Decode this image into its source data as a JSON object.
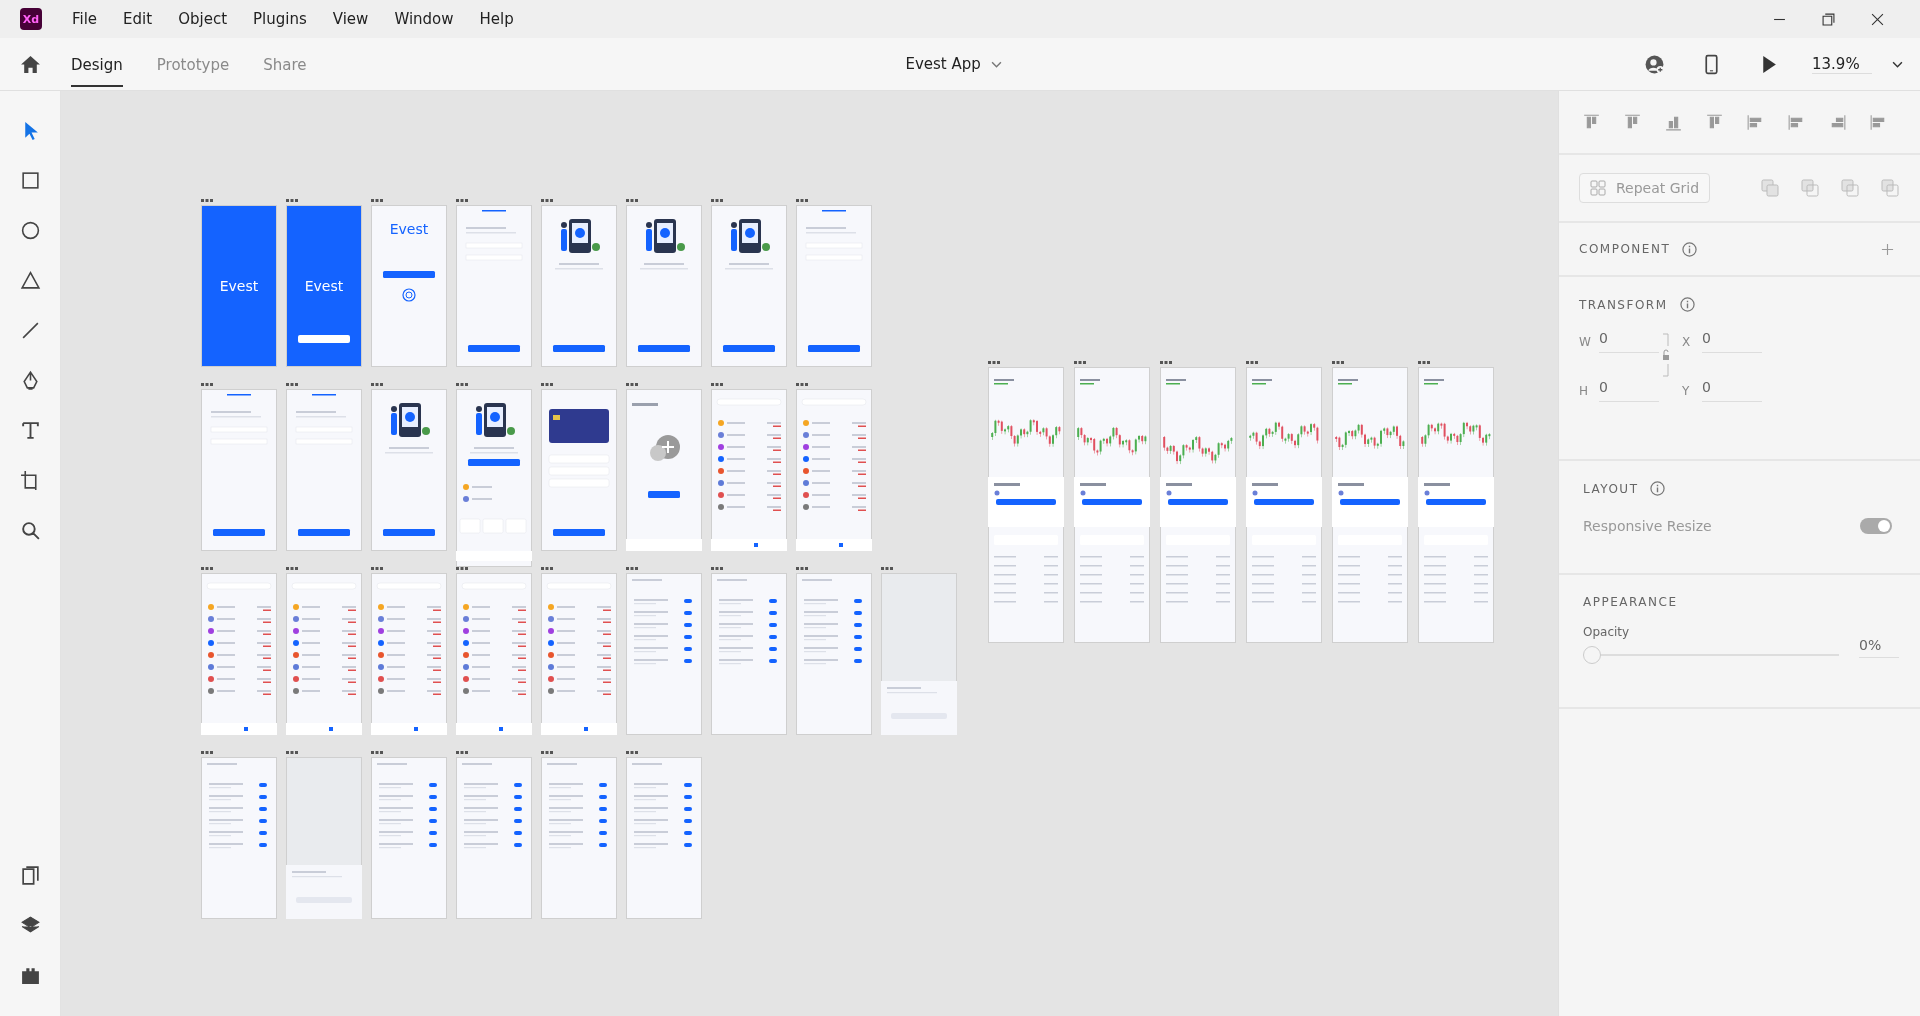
{
  "app": {
    "logo": "Xd"
  },
  "menu": [
    {
      "label": "File"
    },
    {
      "label": "Edit"
    },
    {
      "label": "Object"
    },
    {
      "label": "Plugins"
    },
    {
      "label": "View"
    },
    {
      "label": "Window"
    },
    {
      "label": "Help"
    }
  ],
  "tabs": [
    {
      "label": "Design",
      "selected": true
    },
    {
      "label": "Prototype",
      "selected": false
    },
    {
      "label": "Share",
      "selected": false
    }
  ],
  "document": {
    "title": "Evest App"
  },
  "zoom": "13.9%",
  "tools": [
    {
      "kind": "select",
      "selected": true
    },
    {
      "kind": "rectangle",
      "selected": false
    },
    {
      "kind": "ellipse",
      "selected": false
    },
    {
      "kind": "polygon",
      "selected": false
    },
    {
      "kind": "line",
      "selected": false
    },
    {
      "kind": "pen",
      "selected": false
    },
    {
      "kind": "text",
      "selected": false
    },
    {
      "kind": "artboard",
      "selected": false
    },
    {
      "kind": "zoom",
      "selected": false
    }
  ],
  "bottom_tools": [
    {
      "kind": "assets"
    },
    {
      "kind": "layers"
    },
    {
      "kind": "plugins"
    }
  ],
  "artboard_rows": [
    [
      {
        "kind": "splash",
        "title": "Evest",
        "cta": false
      },
      {
        "kind": "splash",
        "title": "Evest",
        "cta": true
      },
      {
        "kind": "login",
        "title": "Evest"
      },
      {
        "kind": "form"
      },
      {
        "kind": "illustration"
      },
      {
        "kind": "illustration"
      },
      {
        "kind": "illustration"
      },
      {
        "kind": "form"
      }
    ],
    [
      {
        "kind": "form"
      },
      {
        "kind": "form"
      },
      {
        "kind": "illustration"
      },
      {
        "kind": "home"
      },
      {
        "kind": "card"
      },
      {
        "kind": "wallet"
      },
      {
        "kind": "list"
      },
      {
        "kind": "list"
      }
    ],
    [
      {
        "kind": "list"
      },
      {
        "kind": "list"
      },
      {
        "kind": "list"
      },
      {
        "kind": "list"
      },
      {
        "kind": "list"
      },
      {
        "kind": "settings"
      },
      {
        "kind": "settings"
      },
      {
        "kind": "settings"
      },
      {
        "kind": "dialog"
      }
    ],
    [
      {
        "kind": "settings"
      },
      {
        "kind": "dialog"
      },
      {
        "kind": "settings"
      },
      {
        "kind": "settings"
      },
      {
        "kind": "settings"
      },
      {
        "kind": "settings"
      }
    ]
  ],
  "chart_artboards": [
    {
      "kind": "chart"
    },
    {
      "kind": "chart"
    },
    {
      "kind": "chart"
    },
    {
      "kind": "chart"
    },
    {
      "kind": "chart"
    },
    {
      "kind": "chart"
    }
  ],
  "panel": {
    "repeat_grid": "Repeat Grid",
    "component": {
      "heading": "COMPONENT"
    },
    "transform": {
      "heading": "TRANSFORM",
      "fields": [
        {
          "label": "W",
          "value": "0"
        },
        {
          "label": "X",
          "value": "0"
        },
        {
          "label": "H",
          "value": "0"
        },
        {
          "label": "Y",
          "value": "0"
        }
      ]
    },
    "layout": {
      "heading": "LAYOUT",
      "responsive_label": "Responsive Resize",
      "responsive_on": true
    },
    "appearance": {
      "heading": "APPEARANCE",
      "opacity_label": "Opacity",
      "level": 0,
      "opacity_value": "0%"
    }
  }
}
